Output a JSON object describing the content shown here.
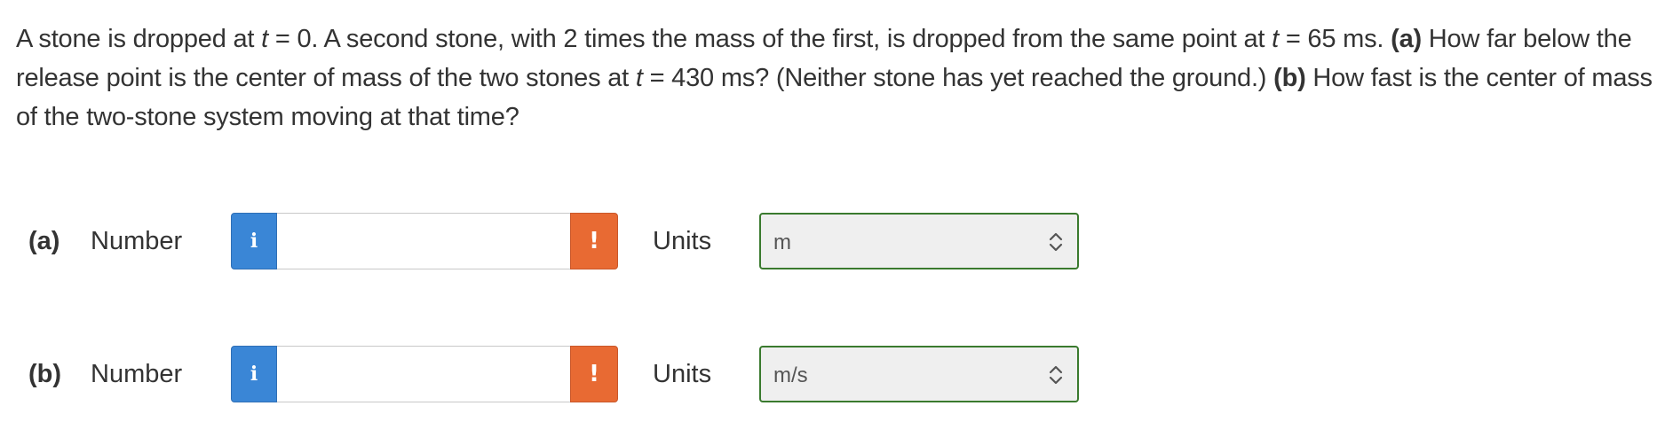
{
  "problem": {
    "p1": "A stone is dropped at ",
    "t1": "t",
    "p2": " = 0. A second stone, with 2 times the mass of the first, is dropped from the same point at ",
    "t2": "t",
    "p3": " = 65 ms. ",
    "a_label": "(a)",
    "p4": " How far below the release point is the center of mass of the two stones at ",
    "t3": "t",
    "p5": " = 430 ms? (Neither stone has yet reached the ground.) ",
    "b_label": "(b)",
    "p6": " How fast is the center of mass of the two-stone system moving at that time?"
  },
  "part_a": {
    "label": "(a)",
    "number_label": "Number",
    "info_glyph": "i",
    "number_value": "",
    "warn_glyph": "!",
    "units_label": "Units",
    "units_value": "m"
  },
  "part_b": {
    "label": "(b)",
    "number_label": "Number",
    "info_glyph": "i",
    "number_value": "",
    "warn_glyph": "!",
    "units_label": "Units",
    "units_value": "m/s"
  },
  "colors": {
    "info_button": "#3a86d6",
    "warn_button": "#e86a33",
    "select_border": "#3a7a2e",
    "select_background": "#efefef",
    "text": "#333333"
  },
  "icons": {
    "info": "info-icon",
    "warning": "exclamation-icon",
    "select": "chevron-up-down-icon"
  }
}
